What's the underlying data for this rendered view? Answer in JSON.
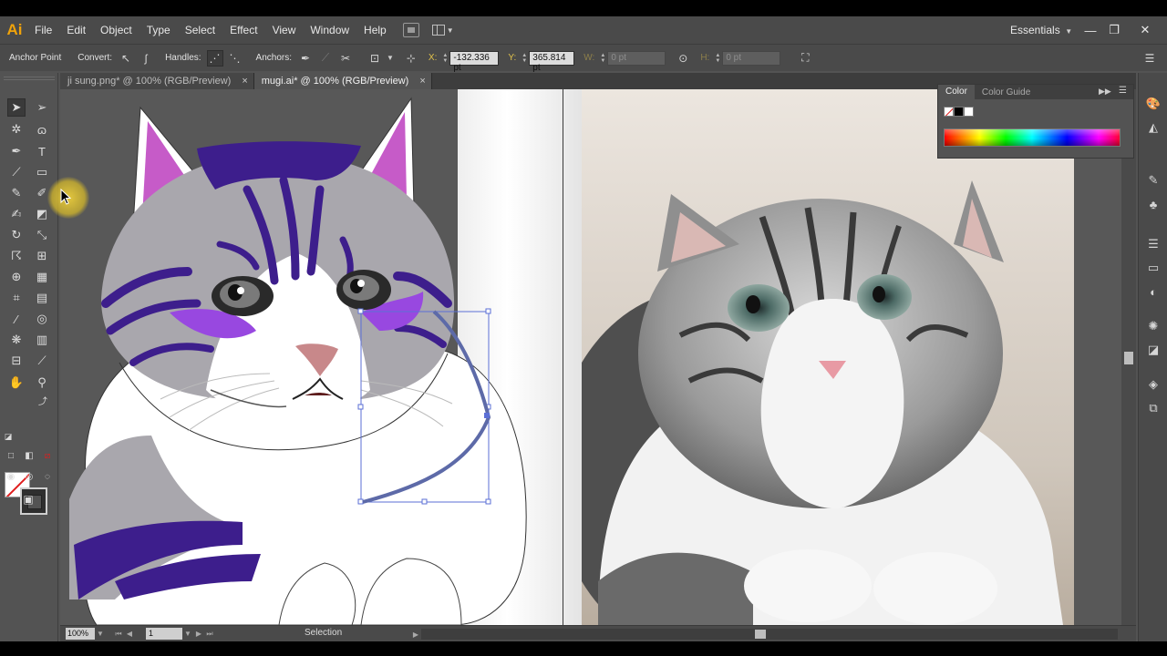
{
  "app": {
    "logo": "Ai"
  },
  "menu": [
    "File",
    "Edit",
    "Object",
    "Type",
    "Select",
    "Effect",
    "View",
    "Window",
    "Help"
  ],
  "workspace": {
    "label": "Essentials"
  },
  "window_controls": {
    "minimize": "—",
    "restore": "❐",
    "close": "✕"
  },
  "control_bar": {
    "tool_label": "Anchor Point",
    "convert_label": "Convert:",
    "handles_label": "Handles:",
    "anchors_label": "Anchors:",
    "x_label": "X:",
    "x_value": "-132.336 pt",
    "y_label": "Y:",
    "y_value": "365.814 pt",
    "w_label": "W:",
    "w_value": "0 pt",
    "h_label": "H:",
    "h_value": "0 pt"
  },
  "tabs": [
    {
      "label": "ji sung.png* @ 100% (RGB/Preview)",
      "close": "×",
      "active": false
    },
    {
      "label": "mugi.ai* @ 100% (RGB/Preview)",
      "close": "×",
      "active": true
    }
  ],
  "status_bar": {
    "zoom": "100%",
    "page": "1",
    "status": "Selection"
  },
  "color_panel": {
    "tabs": [
      "Color",
      "Color Guide"
    ],
    "swatches": [
      "#ffffff",
      "#000000",
      "#ffffff"
    ]
  },
  "colors": {
    "fur_gray": "#a9a7ad",
    "stripe_purple": "#3d1e8c",
    "blush_violet": "#9848e0",
    "ear_pink": "#c65bc8",
    "selection_blue": "#5b6fd6",
    "accent_orange": "#f0a30a"
  }
}
